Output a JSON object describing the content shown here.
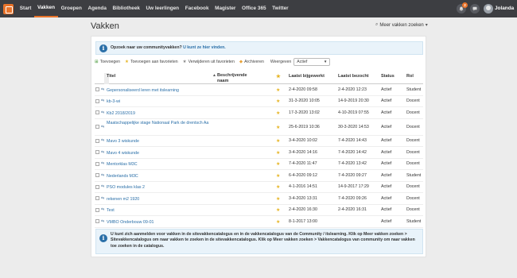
{
  "nav": {
    "items": [
      "Start",
      "Vakken",
      "Groepen",
      "Agenda",
      "Bibliotheek",
      "Uw leerlingen",
      "Facebook",
      "Magister",
      "Office 365",
      "Twitter"
    ],
    "active_index": 1,
    "notification_count": "2",
    "user_name": "Jolanda",
    "accent_color": "#e8732a"
  },
  "header": {
    "title": "Vakken",
    "more_courses_label": "Meer vakken zoeken"
  },
  "info_top": {
    "text": "Opzoek naar uw communityvakken?",
    "link": "U kunt ze hier vinden."
  },
  "toolbar": {
    "add": "Toevoegen",
    "add_fav": "Toevoegen aan favorieten",
    "remove_fav": "Verwijderen uit favorieten",
    "archive": "Archiveren",
    "filter_label": "Weergeven",
    "filter_value": "Actief"
  },
  "table": {
    "headers": {
      "title": "Titel",
      "description": "Beschrijvende naam",
      "updated": "Laatst bijgewerkt",
      "visited": "Laatst bezocht",
      "status": "Status",
      "role": "Rol"
    },
    "rows": [
      {
        "title": "Gepersonaliseerd leren met itslearning",
        "updated": "2-4-2020 09:58",
        "visited": "2-4-2020 12:23",
        "status": "Actief",
        "role": "Student"
      },
      {
        "title": "kb-3-wi",
        "updated": "31-3-2020 10:05",
        "visited": "14-9-2019 20:30",
        "status": "Actief",
        "role": "Docent"
      },
      {
        "title": "Kb2 2018/2019",
        "updated": "17-3-2020 13:02",
        "visited": "4-10-2019 07:55",
        "status": "Actief",
        "role": "Docent"
      },
      {
        "title": "Maatschappelijke stage Nationaal Park de drentsch Aa",
        "updated": "25-6-2019 10:36",
        "visited": "30-3-2020 14:53",
        "status": "Actief",
        "role": "Docent"
      },
      {
        "title": "Mavo 3 wiskunde",
        "updated": "3-4-2020 10:02",
        "visited": "7-4-2020 14:43",
        "status": "Actief",
        "role": "Docent"
      },
      {
        "title": "Mavo 4 wiskunde",
        "updated": "3-4-2020 14:16",
        "visited": "7-4-2020 14:42",
        "status": "Actief",
        "role": "Docent"
      },
      {
        "title": "Mentorklas M3C",
        "updated": "7-4-2020 11:47",
        "visited": "7-4-2020 13:42",
        "status": "Actief",
        "role": "Docent"
      },
      {
        "title": "Nederlands M3C",
        "updated": "6-4-2020 09:12",
        "visited": "7-4-2020 09:27",
        "status": "Actief",
        "role": "Student"
      },
      {
        "title": "PSO modules klas 2",
        "updated": "4-1-2016 14:51",
        "visited": "14-9-2017 17:29",
        "status": "Actief",
        "role": "Docent"
      },
      {
        "title": "rekenen m2 1920",
        "updated": "3-4-2020 13:31",
        "visited": "7-4-2020 09:26",
        "status": "Actief",
        "role": "Docent"
      },
      {
        "title": "Test",
        "updated": "2-4-2020 16:30",
        "visited": "2-4-2020 16:31",
        "status": "Actief",
        "role": "Docent"
      },
      {
        "title": "VMBO Onderbouw 09-01",
        "updated": "8-1-2017 13:00",
        "visited": "",
        "status": "Actief",
        "role": "Student"
      }
    ]
  },
  "info_bottom": {
    "text": "U kunt zich aanmelden voor vakken in de sitevakkencatalogus en in de vakkencatalogus van de Community / itslearning. Klik op Meer vakken zoeken > Sitevakkencatalogus om naar vakken te zoeken in de sitevakkencatalogus. Klik op Meer vakken zoeken > Vakkencatalogus van community om naar vakken toe zoeken in de catalogus."
  }
}
